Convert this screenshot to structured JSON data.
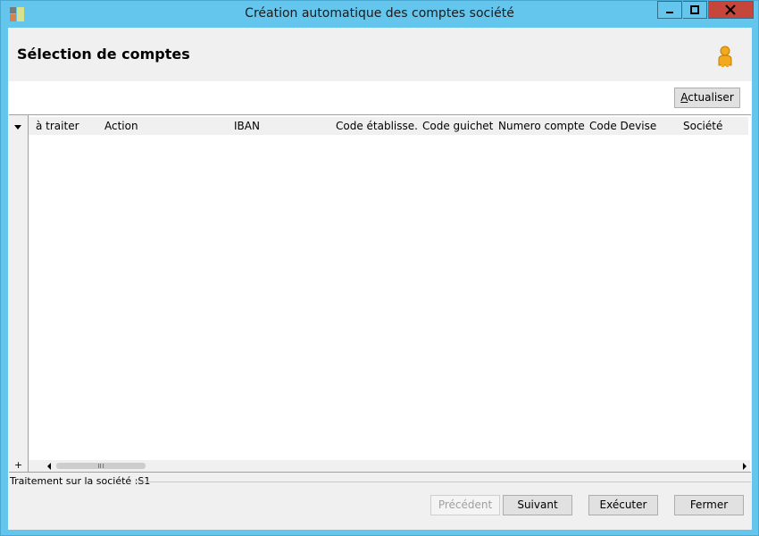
{
  "window": {
    "title": "Création automatique des comptes société",
    "icon": "app-icon",
    "controls": [
      "minimize-icon",
      "maximize-icon",
      "close-icon"
    ],
    "accent_color": "#64c5ed",
    "close_color": "#c7463b"
  },
  "header": {
    "title": "Sélection de comptes",
    "icon": "user-icon"
  },
  "toolbar": {
    "refresh_label": "Actualiser"
  },
  "grid": {
    "columns": [
      "à traiter",
      "Action",
      "IBAN",
      "Code établisse...",
      "Code guichet",
      "Numero compte",
      "Code Devise",
      "Société"
    ],
    "rows": [],
    "add_symbol": "+"
  },
  "status": {
    "text": "Traitement sur la société :S1"
  },
  "footer": {
    "previous_label": "Précédent",
    "next_label": "Suivant",
    "execute_label": "Exécuter",
    "close_label": "Fermer"
  }
}
